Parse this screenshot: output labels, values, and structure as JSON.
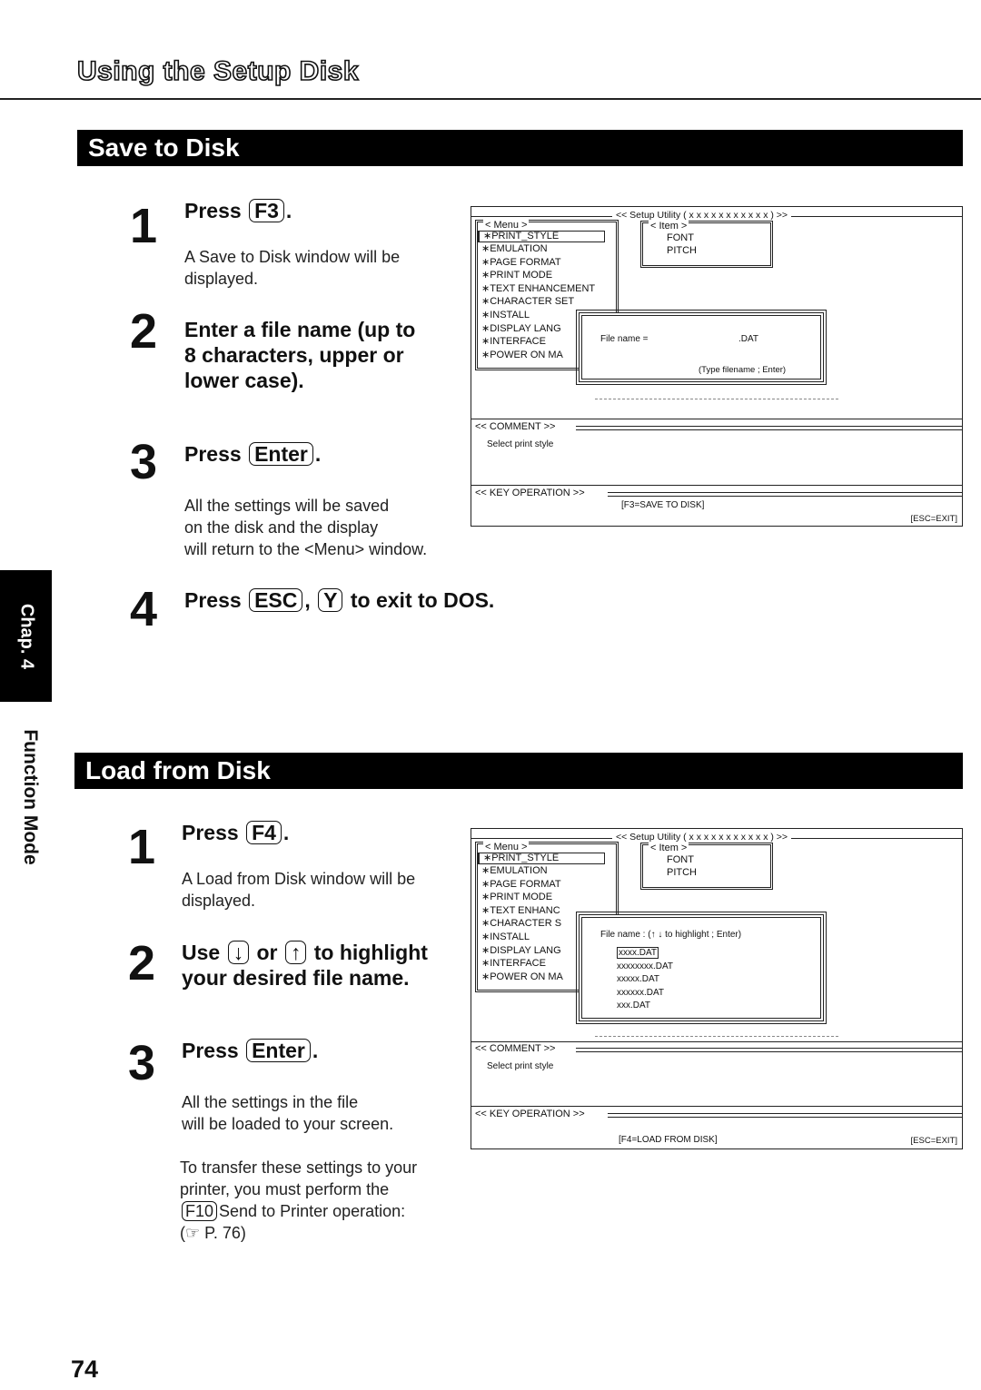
{
  "page": {
    "heading": "Using the Setup Disk",
    "side_tab": "Chap. 4",
    "side_label": "Function Mode",
    "page_number": "74"
  },
  "save": {
    "section_title": "Save to Disk",
    "steps": [
      {
        "num": "1",
        "prefix": "Press",
        "key": "F3",
        "suffix": ".",
        "body": [
          "A Save to Disk window will be",
          "displayed."
        ]
      },
      {
        "num": "2",
        "title_lines": [
          "Enter a file name (up to",
          "8 characters, upper or",
          "lower case)."
        ]
      },
      {
        "num": "3",
        "prefix": "Press",
        "key": "Enter",
        "suffix": ".",
        "body": [
          "All the settings will be saved",
          "on the disk and the display",
          "will return to the <Menu> window."
        ]
      },
      {
        "num": "4",
        "prefix": "Press",
        "key": "ESC",
        "sep": ",",
        "key2": "Y",
        "suffix": "to exit to DOS."
      }
    ],
    "screen": {
      "title": "<< Setup Utility ( x x x x x x x x x x x ) >>",
      "menu_title": "< Menu >",
      "menu_items": [
        "∗PRINT_STYLE",
        "∗EMULATION",
        "∗PAGE FORMAT",
        "∗PRINT MODE",
        "∗TEXT ENHANCEMENT",
        "∗CHARACTER SET",
        "∗INSTALL",
        "∗DISPLAY LANG",
        "∗INTERFACE",
        "∗POWER ON MA"
      ],
      "item_title": "< Item >",
      "item_values": [
        "FONT",
        "PITCH"
      ],
      "dialog_label": "File name =",
      "dialog_ext": ".DAT",
      "dialog_hint": "(Type filename ; Enter)",
      "comment_label": "<< COMMENT >>",
      "comment_text": "Select print style",
      "keyop_label": "<< KEY OPERATION >>",
      "keyop_text": "[F3=SAVE TO DISK]",
      "esc_text": "[ESC=EXIT]"
    }
  },
  "load": {
    "section_title": "Load from Disk",
    "steps": [
      {
        "num": "1",
        "prefix": "Press",
        "key": "F4",
        "suffix": ".",
        "body": [
          "A Load from Disk window will be",
          "displayed."
        ]
      },
      {
        "num": "2",
        "prefix": "Use",
        "key": "↓",
        "mid": "or",
        "key2": "↑",
        "suffix": "to highlight",
        "line2": "your desired file name."
      },
      {
        "num": "3",
        "prefix": "Press",
        "key": "Enter",
        "suffix": ".",
        "body": [
          "All the settings in the file",
          "will be loaded to your screen."
        ],
        "note": [
          "To transfer these settings to your",
          "printer, you must perform the"
        ],
        "note_key": "F10",
        "note_tail": "Send to Printer operation:",
        "note_ref": "(☞ P. 76)"
      }
    ],
    "screen": {
      "title": "<< Setup Utility ( x x x x x x x x x x x ) >>",
      "menu_title": "< Menu >",
      "menu_items": [
        "∗PRINT_STYLE",
        "∗EMULATION",
        "∗PAGE FORMAT",
        "∗PRINT MODE",
        "∗TEXT ENHANC",
        "∗CHARACTER S",
        "∗INSTALL",
        "∗DISPLAY LANG",
        "∗INTERFACE",
        "∗POWER ON MA"
      ],
      "item_title": "< Item >",
      "item_values": [
        "FONT",
        "PITCH"
      ],
      "dialog_label": "File name : (↑ ↓ to highlight ; Enter)",
      "files": [
        "xxxx.DAT",
        "xxxxxxxx.DAT",
        "xxxxx.DAT",
        "xxxxxx.DAT",
        "xxx.DAT"
      ],
      "selected_file": "xxxx.DAT",
      "comment_label": "<< COMMENT >>",
      "comment_text": "Select print style",
      "keyop_label": "<< KEY OPERATION >>",
      "keyop_text": "[F4=LOAD FROM DISK]",
      "esc_text": "[ESC=EXIT]"
    }
  }
}
